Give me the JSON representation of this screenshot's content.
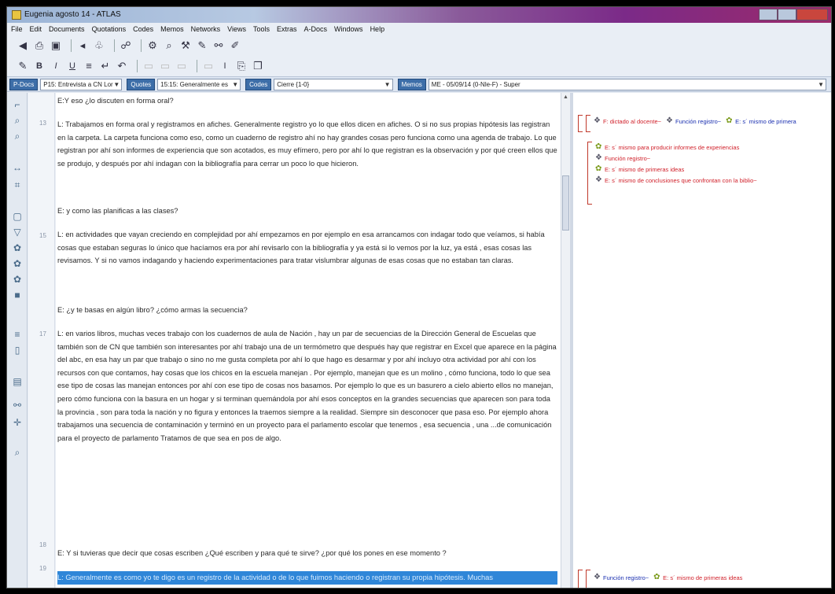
{
  "window": {
    "title": "Eugenia agosto 14 - ATLAS"
  },
  "menu": [
    "File",
    "Edit",
    "Documents",
    "Quotations",
    "Codes",
    "Memos",
    "Networks",
    "Views",
    "Tools",
    "Extras",
    "A-Docs",
    "Windows",
    "Help"
  ],
  "toolbar1_icons": [
    "back-icon",
    "forward-icon",
    "print-icon",
    "save-icon",
    "quotation-icon",
    "marker-icon",
    "network-icon",
    "code-icon",
    "search-icon",
    "tool-icon",
    "pen-icon",
    "link-icon"
  ],
  "toolbar2_icons": [
    "pencil-icon",
    "bold-icon",
    "italic-icon",
    "underline-icon",
    "indent-icon",
    "wrap-icon",
    "undo-icon",
    "font-icon",
    "paste-icon",
    "copy-icon"
  ],
  "selectors": {
    "pdocs_label": "P-Docs",
    "pdocs_value": "P15: Entrevista a CN Lor",
    "quotes_label": "Quotes",
    "quotes_value": "15:15: Generalmente es",
    "codes_label": "Codes",
    "codes_value": "Cierre {1-0}",
    "memos_label": "Memos",
    "memos_value": "ME - 05/09/14 (0-Nle-F) - Super"
  },
  "document": {
    "paragraphs": [
      {
        "text": "E:Y eso ¿lo discuten en forma oral?",
        "line": "",
        "highlighted": false
      },
      {
        "text": "L: Trabajamos en forma oral y registramos en afiches. Generalmente registro yo lo que ellos dicen  en afiches. O si no sus propias hipótesis las registran en la carpeta. La carpeta funciona como eso, como un cuaderno de registro  ahí no hay grandes cosas pero funciona como una agenda de trabajo. Lo que registran por ahí son informes de experiencia que son acotados, es muy efímero,  pero por ahí lo que registran es la observación y por qué creen ellos  que se produjo, y después por ahí indagan con la bibliografía para  cerrar un poco lo que hicieron.",
        "line": "13",
        "highlighted": false
      },
      {
        "text": "E: y como las planificas a las clases?",
        "line": "",
        "highlighted": false
      },
      {
        "text": "L: en actividades que vayan creciendo en complejidad por ahí empezamos  en por ejemplo en esa arrancamos con indagar todo que veíamos, si había cosas que estaban seguras lo único que hacíamos era por ahí revisarlo con la bibliografía y ya está si lo vemos por la luz, ya está , esas cosas las revisamos. Y si no vamos indagando  y haciendo experimentaciones  para tratar vislumbrar algunas de esas cosas que no estaban tan claras.",
        "line": "15",
        "highlighted": false
      },
      {
        "text": "E: ¿y te basas en algún libro? ¿cómo armas la secuencia?",
        "line": "",
        "highlighted": false
      },
      {
        "text": "L: en varios libros,  muchas veces trabajo con los cuadernos de aula de Nación , hay un par de secuencias  de la Dirección General de Escuelas que también son de CN  que también son interesantes  por ahí trabajo una de un termómetro que después hay que registrar en Excel  que aparece en la página del abc, en esa hay un par que trabajo o sino  no me gusta completa por ahí lo que hago  es desarmar y por ahí incluyo otra actividad por ahí con los recursos con que contamos, hay cosas que los chicos en la escuela manejan . Por ejemplo, manejan que es un molino , cómo funciona, todo lo que sea ese tipo de cosas las manejan entonces por ahí con ese tipo de cosas  nos basamos. Por ejemplo lo que es un  basurero a cielo abierto ellos no manejan, pero cómo funciona con la basura en un hogar y si terminan quemándola por ahí esos conceptos en la  grandes secuencias que aparecen  son para toda la provincia  , son para toda la nación y no figura y entonces la traemos siempre   a la realidad. Siempre sin desconocer que pasa eso. Por ejemplo ahora trabajamos una secuencia  de contaminación  y terminó en un proyecto para el parlamento escolar que tenemos , esa secuencia , una ...de comunicación para el proyecto de parlamento Tratamos de que sea  en pos de algo.",
        "line": "17",
        "highlighted": false
      },
      {
        "text": "E: Y si tuvieras que decir que cosas escriben  ¿Qué escriben y para qué te sirve? ¿por qué los pones en ese momento ?",
        "line": "18",
        "highlighted": false
      },
      {
        "text": "L: Generalmente es como yo te digo  es un registro de la actividad  o de lo que fuimos haciendo  o registran su propia hipótesis. Muchas",
        "line": "19",
        "highlighted": true
      }
    ]
  },
  "margin": {
    "group1": [
      {
        "text": "F: dictado al docente~",
        "icon": "family-icon",
        "color": "red"
      },
      {
        "text": "Función registro~",
        "icon": "family-icon",
        "color": "blue"
      },
      {
        "text": "E: s´ mismo de primera",
        "icon": "code-icon",
        "color": "blue"
      }
    ],
    "group2": [
      {
        "text": "E: s´ mismo para producir informes de experiencias",
        "icon": "code-icon",
        "color": "red"
      },
      {
        "text": "Función registro~",
        "icon": "family-icon",
        "color": "red"
      },
      {
        "text": "E: s´ mismo de primeras ideas",
        "icon": "code-icon",
        "color": "red"
      },
      {
        "text": "E: s´ mismo de conclusiones  que confrontan con la biblio~",
        "icon": "family-icon",
        "color": "red"
      }
    ],
    "group3": [
      {
        "text": "Función registro~",
        "icon": "family-icon",
        "color": "blue"
      },
      {
        "text": "E: s´ mismo de primeras ideas",
        "icon": "code-icon",
        "color": "red"
      }
    ]
  },
  "colors": {
    "highlight": "#2f86d8",
    "code_red": "#d0202a",
    "code_blue": "#1a2fb0",
    "selector_button": "#3d6ea8"
  }
}
